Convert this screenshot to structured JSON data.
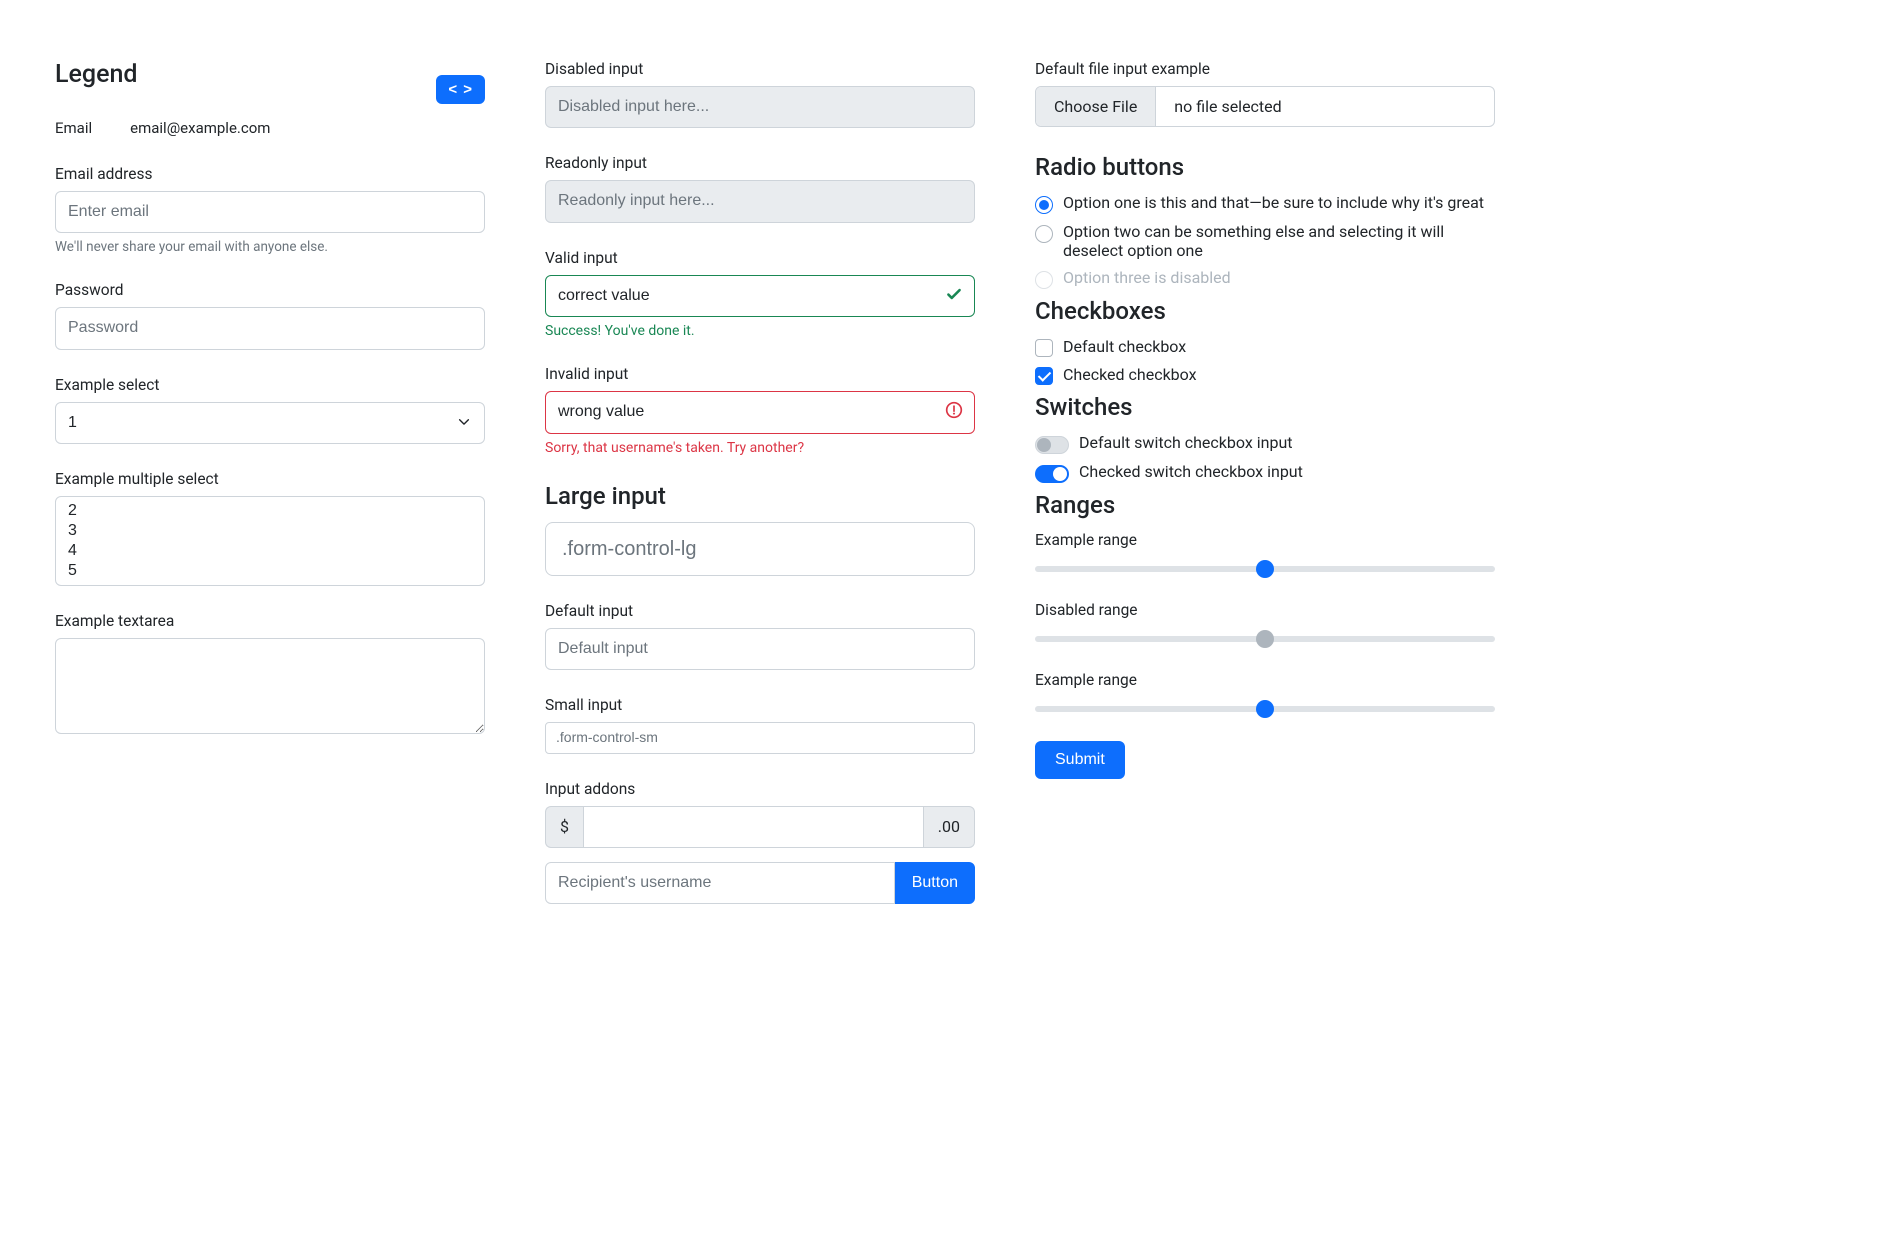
{
  "col1": {
    "legend": "Legend",
    "code_btn": "< >",
    "static_email_label": "Email",
    "static_email_value": "email@example.com",
    "email_label": "Email address",
    "email_placeholder": "Enter email",
    "email_help": "We'll never share your email with anyone else.",
    "password_label": "Password",
    "password_placeholder": "Password",
    "select_label": "Example select",
    "select_value": "1",
    "multiselect_label": "Example multiple select",
    "multiselect_options": [
      "2",
      "3",
      "4",
      "5"
    ],
    "textarea_label": "Example textarea"
  },
  "col2": {
    "disabled_label": "Disabled input",
    "disabled_placeholder": "Disabled input here...",
    "readonly_label": "Readonly input",
    "readonly_placeholder": "Readonly input here...",
    "valid_label": "Valid input",
    "valid_value": "correct value",
    "valid_feedback": "Success! You've done it.",
    "invalid_label": "Invalid input",
    "invalid_value": "wrong value",
    "invalid_feedback": "Sorry, that username's taken. Try another?",
    "large_heading": "Large input",
    "large_placeholder": ".form-control-lg",
    "default_label": "Default input",
    "default_placeholder": "Default input",
    "small_label": "Small input",
    "small_placeholder": ".form-control-sm",
    "addons_label": "Input addons",
    "addon_prefix": "$",
    "addon_suffix": ".00",
    "recipient_placeholder": "Recipient's username",
    "append_button": "Button"
  },
  "col3": {
    "file_label": "Default file input example",
    "file_button": "Choose File",
    "file_text": "no file selected",
    "radio_heading": "Radio buttons",
    "radio1": "Option one is this and that—be sure to include why it's great",
    "radio2": "Option two can be something else and selecting it will deselect option one",
    "radio3": "Option three is disabled",
    "checkbox_heading": "Checkboxes",
    "cb1": "Default checkbox",
    "cb2": "Checked checkbox",
    "switch_heading": "Switches",
    "sw1": "Default switch checkbox input",
    "sw2": "Checked switch checkbox input",
    "ranges_heading": "Ranges",
    "range1_label": "Example range",
    "range2_label": "Disabled range",
    "range3_label": "Example range",
    "submit": "Submit",
    "range1_percent": 50,
    "range2_percent": 50,
    "range3_percent": 50
  }
}
